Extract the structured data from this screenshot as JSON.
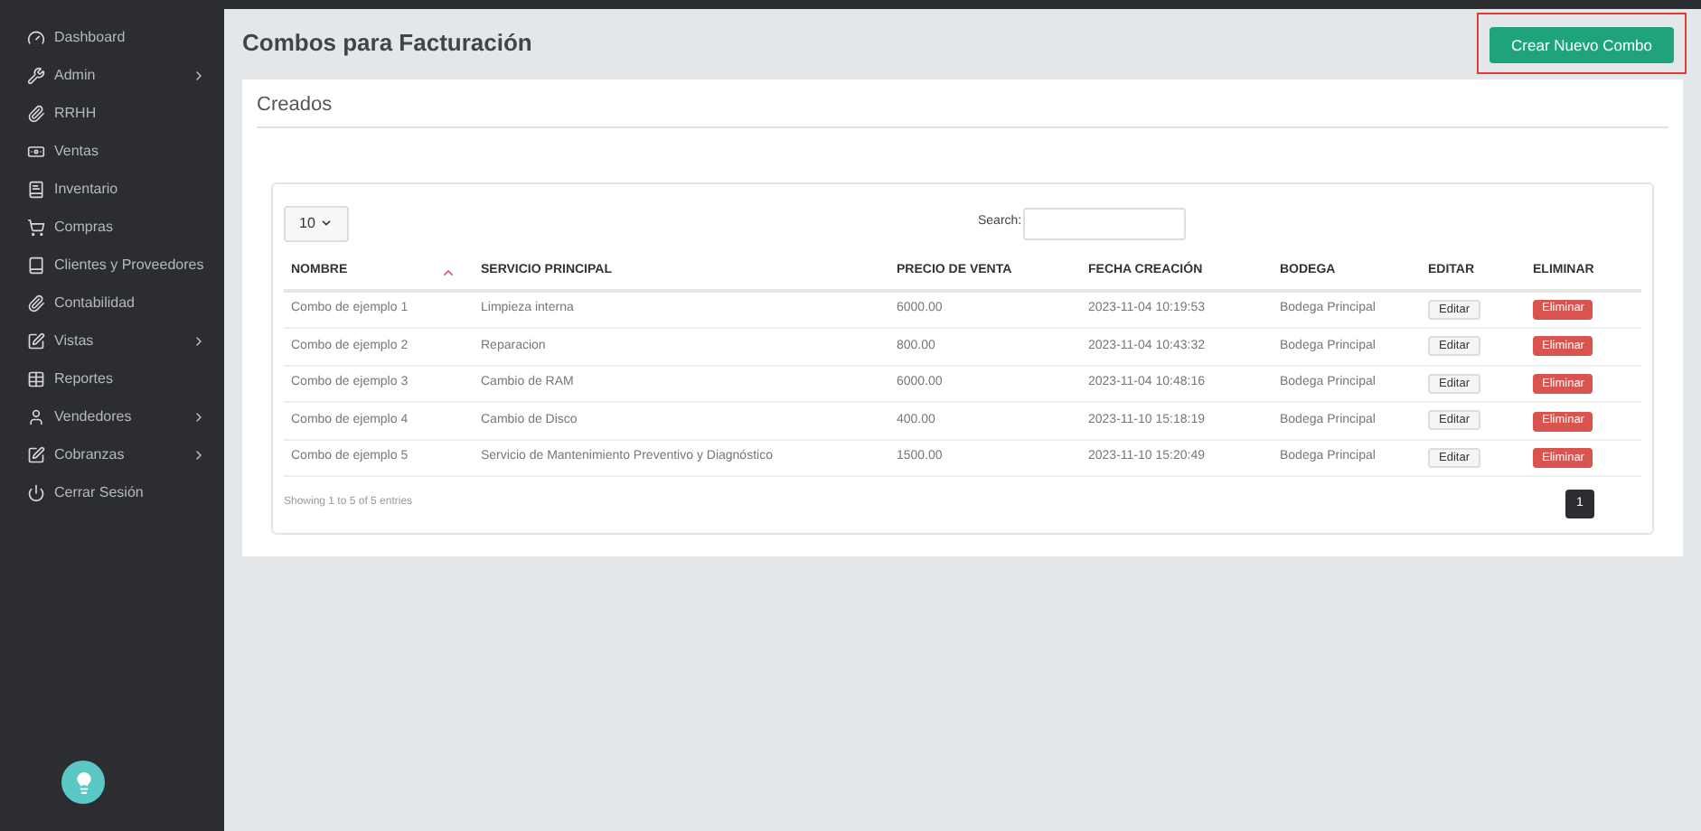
{
  "sidebar": {
    "items": [
      {
        "label": "Dashboard",
        "kind": "link"
      },
      {
        "label": "Admin",
        "kind": "submenu"
      },
      {
        "label": "RRHH",
        "kind": "link"
      },
      {
        "label": "Ventas",
        "kind": "link"
      },
      {
        "label": "Inventario",
        "kind": "link"
      },
      {
        "label": "Compras",
        "kind": "link"
      },
      {
        "label": "Clientes y Proveedores",
        "kind": "link"
      },
      {
        "label": "Contabilidad",
        "kind": "link"
      },
      {
        "label": "Vistas",
        "kind": "submenu"
      },
      {
        "label": "Reportes",
        "kind": "link"
      },
      {
        "label": "Vendedores",
        "kind": "submenu"
      },
      {
        "label": "Cobranzas",
        "kind": "submenu"
      },
      {
        "label": "Cerrar Sesión",
        "kind": "link"
      }
    ]
  },
  "page": {
    "title": "Combos para Facturación",
    "create_button": "Crear Nuevo Combo",
    "highlighted": true,
    "section_title": "Creados"
  },
  "table": {
    "page_size": "10",
    "search_label": "Search:",
    "columns": [
      {
        "label": "NOMBRE",
        "sorted": true
      },
      {
        "label": "SERVICIO PRINCIPAL",
        "sorted": false
      },
      {
        "label": "PRECIO DE VENTA",
        "sorted": false
      },
      {
        "label": "FECHA CREACIÓN",
        "sorted": false
      },
      {
        "label": "BODEGA",
        "sorted": false
      },
      {
        "label": "EDITAR",
        "sorted": false
      },
      {
        "label": "ELIMINAR",
        "sorted": false
      }
    ],
    "rows": [
      {
        "name": "Combo de ejemplo 1",
        "service": "Limpieza interna",
        "price": "6000.00",
        "date": "2023-11-04 10:19:53",
        "warehouse": "Bodega Principal",
        "edit": "Editar",
        "delete": "Eliminar"
      },
      {
        "name": "Combo de ejemplo 2",
        "service": "Reparacion",
        "price": "800.00",
        "date": "2023-11-04 10:43:32",
        "warehouse": "Bodega Principal",
        "edit": "Editar",
        "delete": "Eliminar"
      },
      {
        "name": "Combo de ejemplo 3",
        "service": "Cambio de RAM",
        "price": "6000.00",
        "date": "2023-11-04 10:48:16",
        "warehouse": "Bodega Principal",
        "edit": "Editar",
        "delete": "Eliminar"
      },
      {
        "name": "Combo de ejemplo 4",
        "service": "Cambio de Disco",
        "price": "400.00",
        "date": "2023-11-10 15:18:19",
        "warehouse": "Bodega Principal",
        "edit": "Editar",
        "delete": "Eliminar"
      },
      {
        "name": "Combo de ejemplo 5",
        "service": "Servicio de Mantenimiento Preventivo y Diagnóstico",
        "price": "1500.00",
        "date": "2023-11-10 15:20:49",
        "warehouse": "Bodega Principal",
        "edit": "Editar",
        "delete": "Eliminar"
      }
    ],
    "info": "Showing 1 to 5 of 5 entries",
    "pages": [
      {
        "label": "1",
        "selected": true
      }
    ]
  }
}
